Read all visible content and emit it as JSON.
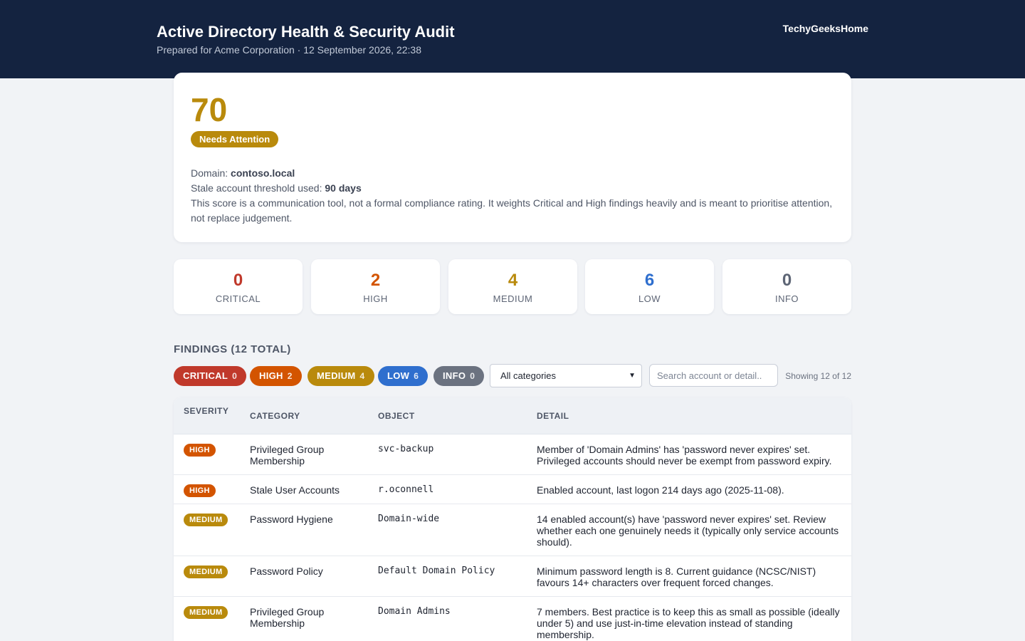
{
  "header": {
    "title": "Active Directory Health & Security Audit",
    "subtitle": "Prepared for Acme Corporation · 12 September 2026, 22:38",
    "brand": "TechyGeeksHome"
  },
  "score": {
    "value": "70",
    "status": "Needs Attention",
    "domain_label": "Domain:",
    "domain": "contoso.local",
    "threshold_label": "Stale account threshold used:",
    "threshold": "90 days",
    "note": "This score is a communication tool, not a formal compliance rating. It weights Critical and High findings heavily and is meant to prioritise attention, not replace judgement."
  },
  "severity_summary": [
    {
      "count": "0",
      "label": "CRITICAL",
      "color": "#c0392b"
    },
    {
      "count": "2",
      "label": "HIGH",
      "color": "#d35400"
    },
    {
      "count": "4",
      "label": "MEDIUM",
      "color": "#b98a0c"
    },
    {
      "count": "6",
      "label": "LOW",
      "color": "#2f6fce"
    },
    {
      "count": "0",
      "label": "INFO",
      "color": "#5d6575"
    }
  ],
  "findings": {
    "heading": "FINDINGS (12 TOTAL)",
    "filters": [
      {
        "label": "CRITICAL",
        "count": "0",
        "color": "#c0392b"
      },
      {
        "label": "HIGH",
        "count": "2",
        "color": "#d35400"
      },
      {
        "label": "MEDIUM",
        "count": "4",
        "color": "#b98a0c"
      },
      {
        "label": "LOW",
        "count": "6",
        "color": "#2f6fce"
      },
      {
        "label": "INFO",
        "count": "0",
        "color": "#6b7280"
      }
    ],
    "category_select": "All categories",
    "search_placeholder": "Search account or detail..",
    "showing": "Showing 12 of 12",
    "columns": {
      "severity": "SEVERITY",
      "category": "CATEGORY",
      "object": "OBJECT",
      "detail": "DETAIL"
    },
    "rows": [
      {
        "severity": "HIGH",
        "color": "#d35400",
        "category": "Privileged Group Membership",
        "object": "svc-backup",
        "detail": "Member of 'Domain Admins' has 'password never expires' set. Privileged accounts should never be exempt from password expiry."
      },
      {
        "severity": "HIGH",
        "color": "#d35400",
        "category": "Stale User Accounts",
        "object": "r.oconnell",
        "detail": "Enabled account, last logon 214 days ago (2025-11-08)."
      },
      {
        "severity": "MEDIUM",
        "color": "#b98a0c",
        "category": "Password Hygiene",
        "object": "Domain-wide",
        "detail": "14 enabled account(s) have 'password never expires' set. Review whether each one genuinely needs it (typically only service accounts should)."
      },
      {
        "severity": "MEDIUM",
        "color": "#b98a0c",
        "category": "Password Policy",
        "object": "Default Domain Policy",
        "detail": "Minimum password length is 8. Current guidance (NCSC/NIST) favours 14+ characters over frequent forced changes."
      },
      {
        "severity": "MEDIUM",
        "color": "#b98a0c",
        "category": "Privileged Group Membership",
        "object": "Domain Admins",
        "detail": "7 members. Best practice is to keep this as small as possible (ideally under 5) and use just-in-time elevation instead of standing membership."
      }
    ]
  }
}
